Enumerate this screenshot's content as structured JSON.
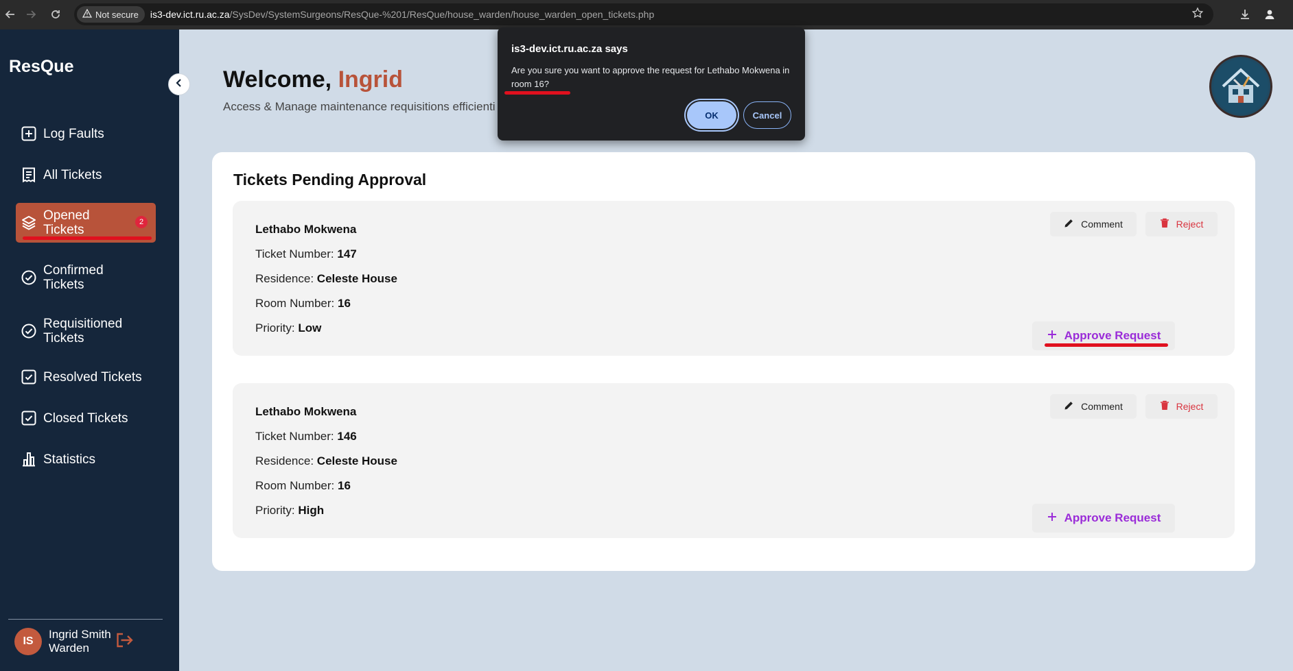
{
  "browser": {
    "security_label": "Not secure",
    "url_host": "is3-dev.ict.ru.ac.za",
    "url_path": "/SysDev/SystemSurgeons/ResQue-%201/ResQue/house_warden/house_warden_open_tickets.php"
  },
  "sidebar": {
    "brand": "ResQue",
    "items": [
      {
        "label": "Log Faults",
        "icon": "plus-square-icon"
      },
      {
        "label": "All Tickets",
        "icon": "receipt-icon"
      },
      {
        "label": "Opened Tickets",
        "icon": "layers-icon",
        "badge": "2"
      },
      {
        "label": "Confirmed Tickets",
        "icon": "check-circle-icon"
      },
      {
        "label": "Requisitioned Tickets",
        "icon": "check-circle-icon"
      },
      {
        "label": "Resolved Tickets",
        "icon": "check-square-icon"
      },
      {
        "label": "Closed Tickets",
        "icon": "check-square-icon"
      },
      {
        "label": "Statistics",
        "icon": "bar-chart-icon"
      }
    ],
    "user": {
      "initials": "IS",
      "name": "Ingrid Smith",
      "role": "Warden"
    }
  },
  "header": {
    "welcome_prefix": "Welcome,",
    "welcome_name": "Ingrid",
    "subtitle": "Access & Manage maintenance requisitions efficienti"
  },
  "panel": {
    "title": "Tickets Pending Approval",
    "tickets": [
      {
        "name": "Lethabo Mokwena",
        "ticket_label": "Ticket Number:",
        "ticket_number": "147",
        "residence_label": "Residence:",
        "residence": "Celeste House",
        "room_label": "Room Number:",
        "room": "16",
        "priority_label": "Priority:",
        "priority": "Low"
      },
      {
        "name": "Lethabo Mokwena",
        "ticket_label": "Ticket Number:",
        "ticket_number": "146",
        "residence_label": "Residence:",
        "residence": "Celeste House",
        "room_label": "Room Number:",
        "room": "16",
        "priority_label": "Priority:",
        "priority": "High"
      }
    ],
    "comment_label": "Comment",
    "reject_label": "Reject",
    "approve_label": "Approve Request"
  },
  "dialog": {
    "title": "is3-dev.ict.ru.ac.za says",
    "message": "Are you sure you want to approve the request for Lethabo Mokwena in room 16?",
    "ok_label": "OK",
    "cancel_label": "Cancel"
  },
  "colors": {
    "accent": "#b8533a",
    "sidebar": "#15263b",
    "approve": "#9a2bd8",
    "reject": "#d9343f",
    "highlight": "#e0101e"
  }
}
